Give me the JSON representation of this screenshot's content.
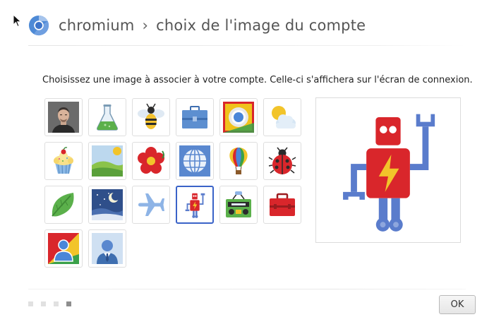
{
  "header": {
    "app_name": "chromium",
    "separator": "›",
    "page_title": "choix de l'image du compte"
  },
  "instructions": "Choisissez une image à associer à votre compte. Celle-ci s'affichera sur l'écran de connexion.",
  "images": [
    {
      "icon": "profile-photo-icon"
    },
    {
      "icon": "flask-icon"
    },
    {
      "icon": "bee-icon"
    },
    {
      "icon": "briefcase-icon"
    },
    {
      "icon": "chrome-logo-icon"
    },
    {
      "icon": "sun-cloud-icon"
    },
    {
      "icon": "cupcake-icon"
    },
    {
      "icon": "landscape-icon"
    },
    {
      "icon": "flower-icon"
    },
    {
      "icon": "globe-icon"
    },
    {
      "icon": "hot-air-balloon-icon"
    },
    {
      "icon": "ladybug-icon"
    },
    {
      "icon": "leaf-icon"
    },
    {
      "icon": "night-sky-icon"
    },
    {
      "icon": "airplane-icon"
    },
    {
      "icon": "robot-icon",
      "selected": true
    },
    {
      "icon": "radio-icon"
    },
    {
      "icon": "toolbox-icon"
    },
    {
      "icon": "google-profile-icon"
    },
    {
      "icon": "business-person-icon"
    }
  ],
  "preview": {
    "icon": "robot-icon"
  },
  "progress": {
    "total_steps": 4,
    "current_step": 4
  },
  "buttons": {
    "ok_label": "OK"
  },
  "colors": {
    "selection_border": "#3a63c8",
    "robot_red": "#d9262b",
    "robot_blue": "#5a7ccc"
  }
}
